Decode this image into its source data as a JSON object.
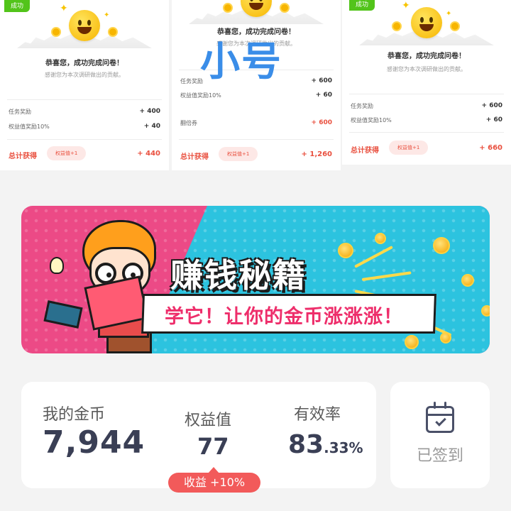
{
  "result_cards": [
    {
      "badge": "成功",
      "title": "恭喜您，成功完成问卷！",
      "subtitle": "感谢您为本次调研做出的贡献。",
      "rows": [
        {
          "label": "任务奖励",
          "value": "+ 400"
        },
        {
          "label": "权益值奖励10%",
          "value": "+ 40"
        }
      ],
      "total_label": "总计获得",
      "pill": "权益值+1",
      "total_value": "+ 440"
    },
    {
      "badge": "",
      "title": "恭喜您，成功完成问卷！",
      "subtitle": "感谢您为本次调研做出的贡献。",
      "rows": [
        {
          "label": "任务奖励",
          "value": "+ 600"
        },
        {
          "label": "权益值奖励10%",
          "value": "+ 60"
        },
        {
          "label": "翻倍券",
          "value": "+ 600"
        }
      ],
      "total_label": "总计获得",
      "pill": "权益值+1",
      "total_value": "+ 1,260"
    },
    {
      "badge": "成功",
      "title": "恭喜您，成功完成问卷！",
      "subtitle": "感谢您为本次调研做出的贡献。",
      "rows": [
        {
          "label": "任务奖励",
          "value": "+ 600"
        },
        {
          "label": "权益值奖励10%",
          "value": "+ 60"
        }
      ],
      "total_label": "总计获得",
      "pill": "权益值+1",
      "total_value": "+ 660"
    }
  ],
  "watermark": "小号",
  "banner": {
    "title": "赚钱秘籍",
    "subtitle": "学它！让你的金币涨涨涨！"
  },
  "stats": {
    "coins_label": "我的金币",
    "coins_value": "7,944",
    "rights_label": "权益值",
    "rights_value": "77",
    "bonus": "收益 +10%",
    "efficiency_label": "有效率",
    "efficiency_main": "83",
    "efficiency_frac": ".33%"
  },
  "checkin": {
    "label": "已签到",
    "icon": "calendar-check-icon"
  },
  "colors": {
    "accent_red": "#e9503f",
    "success_green": "#52c41a",
    "banner_pink": "#ec4a86",
    "banner_blue": "#2cc3df",
    "stat_text": "#3a3f55"
  }
}
